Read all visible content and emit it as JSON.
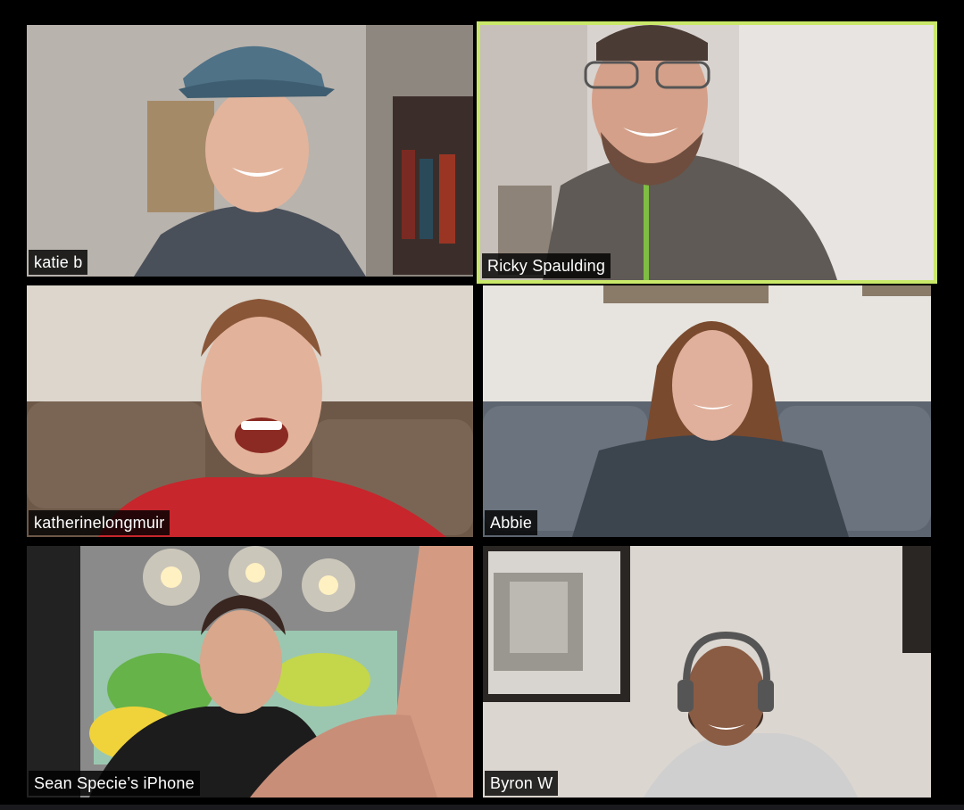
{
  "meeting": {
    "active_speaker_color": "#c9e86a",
    "participants": [
      {
        "name": "katie b"
      },
      {
        "name": "Ricky Spaulding",
        "active": true
      },
      {
        "name": "katherinelongmuir"
      },
      {
        "name": "Abbie"
      },
      {
        "name": "Sean Specie’s iPhone"
      },
      {
        "name": "Byron W"
      }
    ]
  }
}
